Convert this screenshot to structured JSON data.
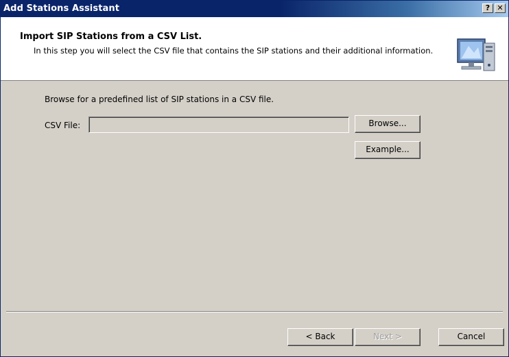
{
  "window": {
    "title": "Add Stations Assistant",
    "help_button": "?",
    "close_button": "✕"
  },
  "header": {
    "title": "Import SIP Stations from a CSV List.",
    "subtitle": "In this step you will select the CSV file that contains the SIP stations and their additional information.",
    "icon": "computer-icon"
  },
  "content": {
    "intro": "Browse for a predefined list of SIP stations in a CSV file.",
    "csv_label": "CSV File:",
    "csv_value": "",
    "browse_label": "Browse...",
    "example_label": "Example..."
  },
  "footer": {
    "back_label": "< Back",
    "next_label": "Next >",
    "cancel_label": "Cancel"
  },
  "colors": {
    "titlebar": "#0a246a",
    "dialog_bg": "#d4d0c8",
    "header_bg": "#ffffff"
  }
}
